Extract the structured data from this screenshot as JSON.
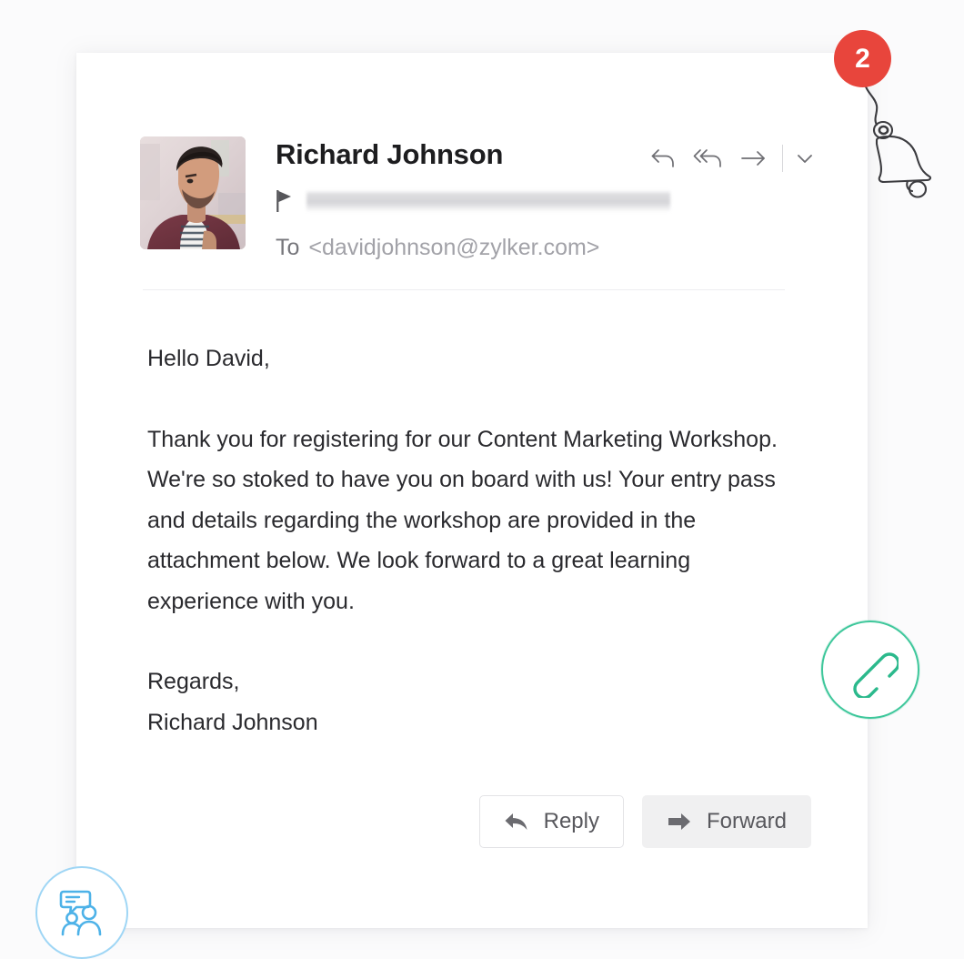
{
  "app": {
    "background_color": "#fbfbfc",
    "card_background": "#ffffff"
  },
  "notification": {
    "count": "2",
    "badge_color": "#e8453c",
    "icon": "bell-icon",
    "icon_style": "hand-drawn-sketch"
  },
  "email": {
    "sender": {
      "name": "Richard Johnson",
      "avatar": "sender-photo"
    },
    "subject": {
      "flag_icon": "flag-icon",
      "value": "",
      "redacted": true
    },
    "recipient": {
      "label": "To",
      "address": "<davidjohnson@zylker.com>"
    },
    "header_actions": [
      {
        "name": "reply-icon",
        "label": "Reply"
      },
      {
        "name": "reply-all-icon",
        "label": "Reply All"
      },
      {
        "name": "forward-icon",
        "label": "Forward"
      },
      {
        "name": "chevron-down-icon",
        "label": "More"
      }
    ],
    "body": {
      "greeting": "Hello David,",
      "paragraph": "Thank you for registering for our Content Marketing Workshop. We're so stoked to have you on board with us! Your entry pass and details regarding the workshop are provided in the attachment below. We look forward to a great learning experience with you.",
      "sign_off": "Regards,",
      "signature_name": "Richard Johnson"
    },
    "actions": {
      "reply_label": "Reply",
      "forward_label": "Forward",
      "reply_icon": "reply-arrow-icon",
      "forward_icon": "forward-arrow-icon"
    }
  },
  "floating_icons": [
    {
      "name": "attachment-link-icon",
      "color": "#3ec79b",
      "style": "hand-drawn-sketch",
      "depicts": "chain-link"
    },
    {
      "name": "discussion-icon",
      "color": "#9fd6f5",
      "style": "hand-drawn-sketch",
      "depicts": "two-people-with-speech-bubble"
    }
  ]
}
